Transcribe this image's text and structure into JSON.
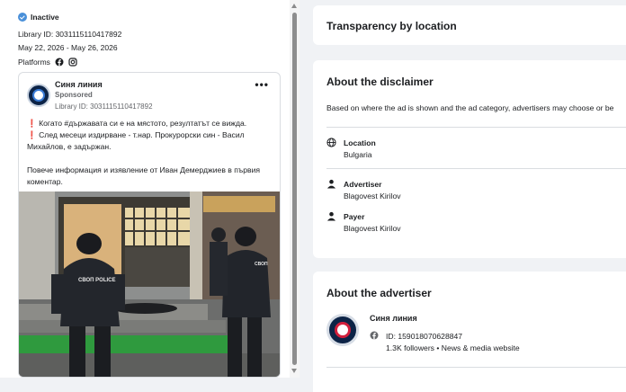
{
  "left": {
    "status": "Inactive",
    "library_id": "Library ID: 3031115110417892",
    "dates": "May 22, 2026 - May 26, 2026",
    "platforms_label": "Platforms",
    "platform_icons": [
      "facebook-icon",
      "instagram-icon"
    ]
  },
  "ad": {
    "page_name": "Синя линия",
    "sponsored": "Sponsored",
    "library_id": "Library ID: 3031115110417892",
    "more_label": "•••",
    "line1": "Когато #държавата си е на мястото, резултатът се вижда.",
    "line2": "След месеци издирване - т.нар. Прокурорски син - Васил Михайлов, е задържан.",
    "line3": "Повече информация и изявление от Иван Демерджиев в първия коментар.",
    "police_text": "СВОП POLICE"
  },
  "transparency": {
    "title": "Transparency by location"
  },
  "disclaimer": {
    "title": "About the disclaimer",
    "description": "Based on where the ad is shown and the ad category, advertisers may choose or be",
    "location_label": "Location",
    "location_value": "Bulgaria",
    "advertiser_label": "Advertiser",
    "advertiser_value": "Blagovest Kirilov",
    "payer_label": "Payer",
    "payer_value": "Blagovest Kirilov"
  },
  "advertiser": {
    "title": "About the advertiser",
    "name": "Синя линия",
    "id": "ID: 159018070628847",
    "followers": "1.3K followers • News & media website"
  },
  "colors": {
    "accent": "#4a90d9",
    "alert": "#d21f3c",
    "background": "#f0f2f5"
  }
}
